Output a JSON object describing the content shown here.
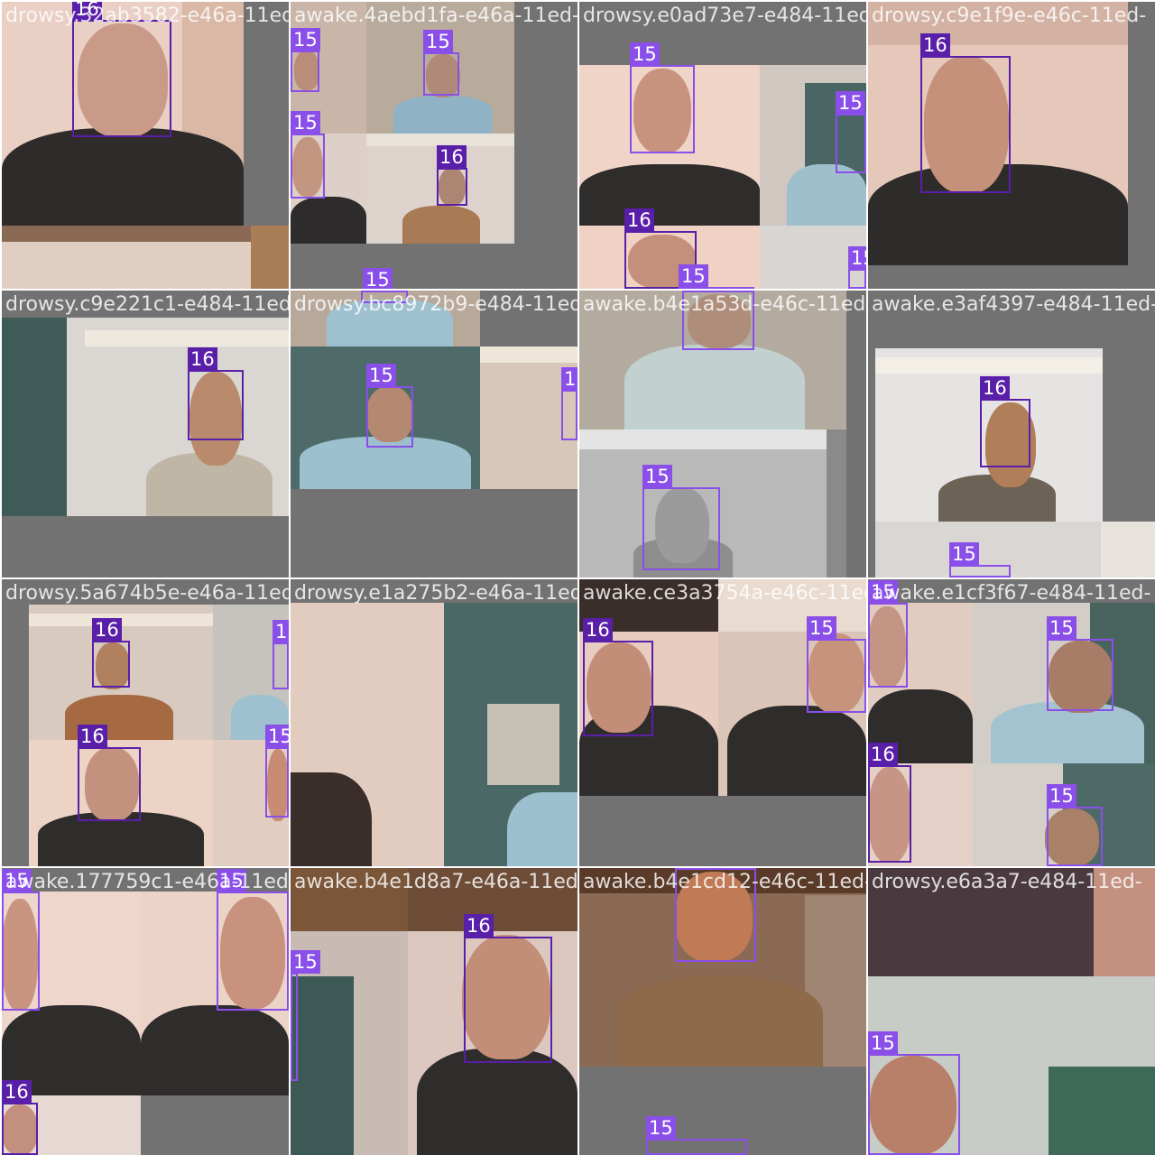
{
  "tiles": [
    {
      "filename": "drowsy.32ab3582-e46a-11ed-",
      "boxes": [
        {
          "label": "16"
        }
      ]
    },
    {
      "filename": "awake.4aebd1fa-e46a-11ed-",
      "boxes": [
        {
          "label": "15"
        },
        {
          "label": "15"
        },
        {
          "label": "15"
        },
        {
          "label": "16"
        },
        {
          "label": "15"
        }
      ]
    },
    {
      "filename": "drowsy.e0ad73e7-e484-11ed-",
      "boxes": [
        {
          "label": "15"
        },
        {
          "label": "15"
        },
        {
          "label": "16"
        },
        {
          "label": "15"
        },
        {
          "label": "15"
        }
      ]
    },
    {
      "filename": "drowsy.c9e1f9e-e46c-11ed-",
      "boxes": [
        {
          "label": "16"
        }
      ]
    },
    {
      "filename": "drowsy.c9e221c1-e484-11ed-",
      "boxes": [
        {
          "label": "16"
        }
      ]
    },
    {
      "filename": "drowsy.bc8972b9-e484-11ed-",
      "boxes": [
        {
          "label": "15"
        },
        {
          "label": "15"
        },
        {
          "label": "15"
        }
      ]
    },
    {
      "filename": "awake.b4e1a53d-e46c-11ed-",
      "boxes": [
        {
          "label": "15"
        },
        {
          "label": "15"
        }
      ]
    },
    {
      "filename": "awake.e3af4397-e484-11ed-",
      "boxes": [
        {
          "label": "16"
        },
        {
          "label": "15"
        }
      ]
    },
    {
      "filename": "drowsy.5a674b5e-e46a-11ed-",
      "boxes": [
        {
          "label": "16"
        },
        {
          "label": "15"
        },
        {
          "label": "16"
        },
        {
          "label": "15"
        }
      ]
    },
    {
      "filename": "drowsy.e1a275b2-e46a-11ed-",
      "boxes": []
    },
    {
      "filename": "awake.ce3a3754a-e46c-11ed-",
      "boxes": [
        {
          "label": "16"
        },
        {
          "label": "15"
        }
      ]
    },
    {
      "filename": "awake.e1cf3f67-e484-11ed-",
      "boxes": [
        {
          "label": "15"
        },
        {
          "label": "15"
        },
        {
          "label": "16"
        },
        {
          "label": "15"
        }
      ]
    },
    {
      "filename": "awake.177759c1-e46a-11ed-",
      "boxes": [
        {
          "label": "15"
        },
        {
          "label": "15"
        },
        {
          "label": "16"
        }
      ]
    },
    {
      "filename": "awake.b4e1d8a7-e46a-11ed-",
      "boxes": [
        {
          "label": "15"
        },
        {
          "label": "16"
        }
      ]
    },
    {
      "filename": "awake.b4e1cd12-e46c-11ed-",
      "boxes": [
        {
          "label": "15"
        },
        {
          "label": "15"
        }
      ]
    },
    {
      "filename": "drowsy.e6a3a7-e484-11ed-",
      "boxes": [
        {
          "label": "15"
        }
      ]
    }
  ],
  "colors": {
    "class15": "#8a4fe8",
    "class16": "#5a1fa8",
    "padding": "#727272"
  }
}
